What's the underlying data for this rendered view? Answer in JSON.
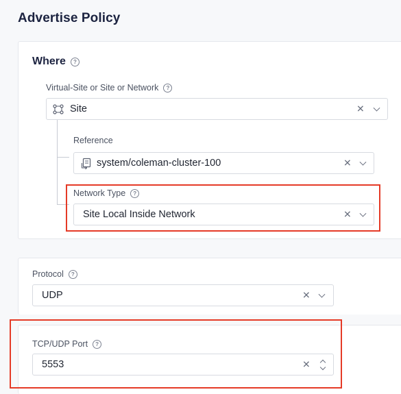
{
  "page": {
    "title": "Advertise Policy"
  },
  "where": {
    "title": "Where",
    "virtual_site": {
      "label": "Virtual-Site or Site or Network",
      "value": "Site",
      "icon": "site-network-icon"
    },
    "reference": {
      "label": "Reference",
      "value": "system/coleman-cluster-100",
      "icon": "reference-icon"
    },
    "network_type": {
      "label": "Network Type",
      "value": "Site Local Inside Network"
    }
  },
  "protocol": {
    "label": "Protocol",
    "value": "UDP"
  },
  "port": {
    "label": "TCP/UDP Port",
    "value": "5553"
  },
  "colors": {
    "accent_highlight": "#e53a26",
    "title": "#1c2340",
    "border": "#d7dae0"
  }
}
